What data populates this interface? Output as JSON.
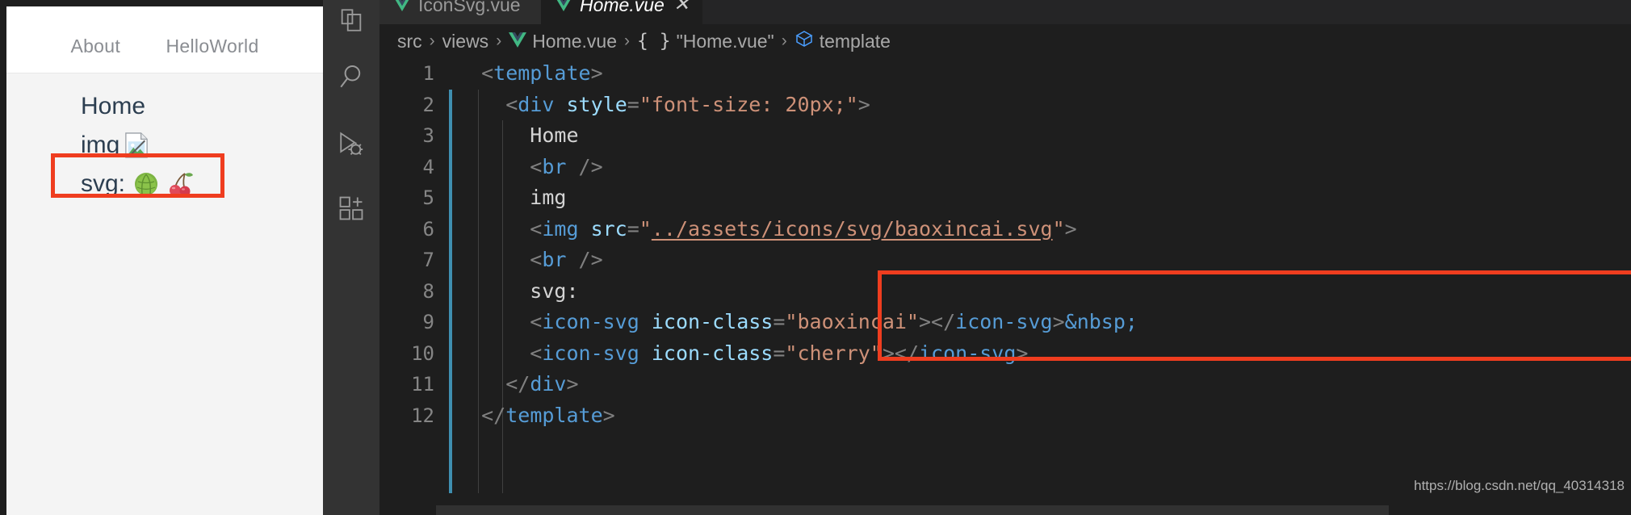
{
  "browser": {
    "nav": [
      {
        "label": "About",
        "name": "nav-link-about"
      },
      {
        "label": "HelloWorld",
        "name": "nav-link-helloworld"
      }
    ],
    "content": {
      "home_label": "Home",
      "img_label": "img",
      "svg_label": "svg:",
      "img_icon": "broken-image-icon",
      "svg_icon_1": "cabbage-icon",
      "svg_icon_2": "cherry-icon"
    },
    "highlight_color": "#ef3d1f"
  },
  "vscode": {
    "activity_bar": {
      "items": [
        {
          "name": "explorer-icon",
          "label": "Explorer"
        },
        {
          "name": "search-icon",
          "label": "Search"
        },
        {
          "name": "run-and-debug-icon",
          "label": "Run and Debug"
        },
        {
          "name": "extensions-icon",
          "label": "Extensions"
        }
      ]
    },
    "tabs": [
      {
        "label": "IconSvg.vue",
        "active": false,
        "icon": "vue-icon",
        "close": ""
      },
      {
        "label": "Home.vue",
        "active": true,
        "icon": "vue-icon",
        "close": "✕"
      }
    ],
    "breadcrumb": [
      {
        "label": "src",
        "icon": ""
      },
      {
        "label": "views",
        "icon": ""
      },
      {
        "label": "Home.vue",
        "icon": "vue-icon"
      },
      {
        "label": "\"Home.vue\"",
        "icon": "braces-icon"
      },
      {
        "label": "template",
        "icon": "symbol-namespace-icon"
      }
    ],
    "breadcrumb_separator": "›",
    "code": {
      "language": "vue-html",
      "lines": [
        {
          "n": "1",
          "tokens": [
            {
              "t": "punct",
              "v": "  <"
            },
            {
              "t": "tag",
              "v": "template"
            },
            {
              "t": "punct",
              "v": ">"
            }
          ]
        },
        {
          "n": "2",
          "tokens": [
            {
              "t": "punct",
              "v": "    <"
            },
            {
              "t": "tag",
              "v": "div"
            },
            {
              "t": "text",
              "v": " "
            },
            {
              "t": "attr",
              "v": "style"
            },
            {
              "t": "punct",
              "v": "="
            },
            {
              "t": "str",
              "v": "\"font-size: 20px;\""
            },
            {
              "t": "punct",
              "v": ">"
            }
          ]
        },
        {
          "n": "3",
          "tokens": [
            {
              "t": "text",
              "v": "      Home"
            }
          ]
        },
        {
          "n": "4",
          "tokens": [
            {
              "t": "punct",
              "v": "      <"
            },
            {
              "t": "tag",
              "v": "br"
            },
            {
              "t": "punct",
              "v": " />"
            }
          ]
        },
        {
          "n": "5",
          "tokens": [
            {
              "t": "text",
              "v": "      img"
            }
          ]
        },
        {
          "n": "6",
          "tokens": [
            {
              "t": "punct",
              "v": "      <"
            },
            {
              "t": "tag",
              "v": "img"
            },
            {
              "t": "text",
              "v": " "
            },
            {
              "t": "attr",
              "v": "src"
            },
            {
              "t": "punct",
              "v": "="
            },
            {
              "t": "str",
              "v": "\""
            },
            {
              "t": "link",
              "v": "../assets/icons/svg/baoxincai.svg"
            },
            {
              "t": "str",
              "v": "\""
            },
            {
              "t": "punct",
              "v": ">"
            }
          ]
        },
        {
          "n": "7",
          "tokens": [
            {
              "t": "punct",
              "v": "      <"
            },
            {
              "t": "tag",
              "v": "br"
            },
            {
              "t": "punct",
              "v": " />"
            }
          ]
        },
        {
          "n": "8",
          "tokens": [
            {
              "t": "text",
              "v": "      svg:"
            }
          ]
        },
        {
          "n": "9",
          "tokens": [
            {
              "t": "punct",
              "v": "      <"
            },
            {
              "t": "tag",
              "v": "icon-svg"
            },
            {
              "t": "text",
              "v": " "
            },
            {
              "t": "attr",
              "v": "icon-class"
            },
            {
              "t": "punct",
              "v": "="
            },
            {
              "t": "str",
              "v": "\"baoxincai\""
            },
            {
              "t": "punct",
              "v": "></"
            },
            {
              "t": "tag",
              "v": "icon-svg"
            },
            {
              "t": "punct",
              "v": ">"
            },
            {
              "t": "entity",
              "v": "&nbsp;"
            }
          ]
        },
        {
          "n": "10",
          "tokens": [
            {
              "t": "punct",
              "v": "      <"
            },
            {
              "t": "tag",
              "v": "icon-svg"
            },
            {
              "t": "text",
              "v": " "
            },
            {
              "t": "attr",
              "v": "icon-class"
            },
            {
              "t": "punct",
              "v": "="
            },
            {
              "t": "str",
              "v": "\"cherry\""
            },
            {
              "t": "punct",
              "v": "></"
            },
            {
              "t": "tag",
              "v": "icon-svg"
            },
            {
              "t": "punct",
              "v": ">"
            }
          ]
        },
        {
          "n": "11",
          "tokens": [
            {
              "t": "punct",
              "v": "    </"
            },
            {
              "t": "tag",
              "v": "div"
            },
            {
              "t": "punct",
              "v": ">"
            }
          ]
        },
        {
          "n": "12",
          "tokens": [
            {
              "t": "punct",
              "v": "  </"
            },
            {
              "t": "tag",
              "v": "template"
            },
            {
              "t": "punct",
              "v": ">"
            }
          ]
        }
      ]
    },
    "highlight_color": "#ef3d1f"
  },
  "watermark": "https://blog.csdn.net/qq_40314318"
}
